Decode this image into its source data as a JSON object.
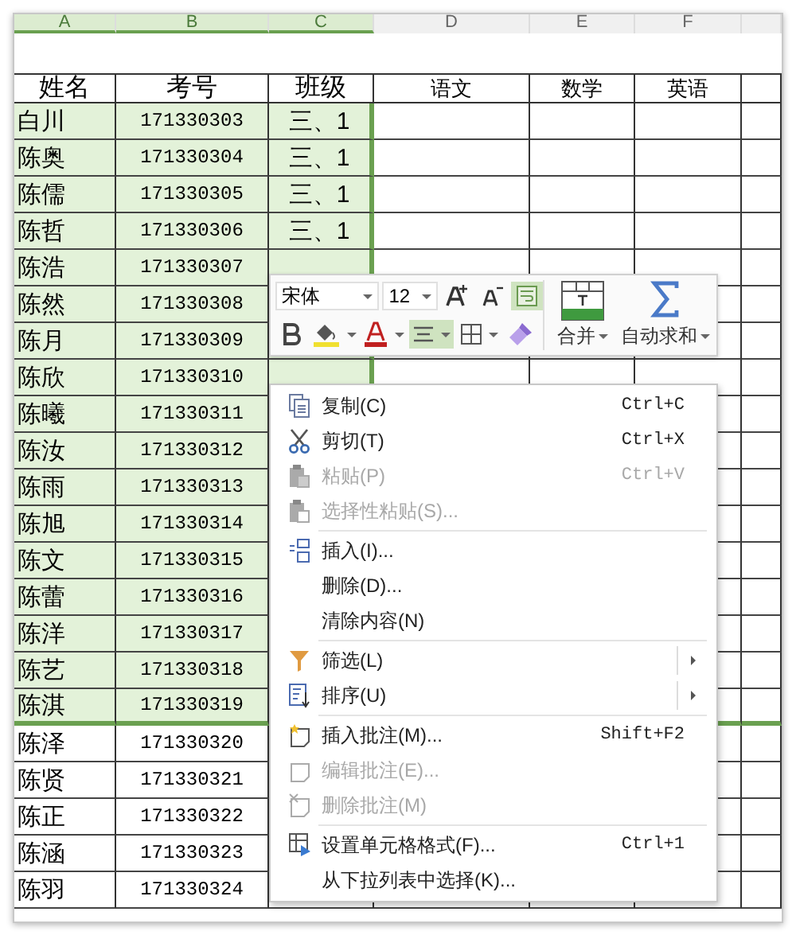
{
  "column_headers": [
    {
      "label": "A",
      "selected": true
    },
    {
      "label": "B",
      "selected": true
    },
    {
      "label": "C",
      "selected": true
    },
    {
      "label": "D",
      "selected": false
    },
    {
      "label": "E",
      "selected": false
    },
    {
      "label": "F",
      "selected": false
    }
  ],
  "table": {
    "columns": [
      "姓名",
      "考号",
      "班级",
      "语文",
      "数学",
      "英语"
    ],
    "rows": [
      {
        "name": "白川",
        "id": "171330303",
        "class": "三、1",
        "selected": true
      },
      {
        "name": "陈奥",
        "id": "171330304",
        "class": "三、1",
        "selected": true
      },
      {
        "name": "陈儒",
        "id": "171330305",
        "class": "三、1",
        "selected": true
      },
      {
        "name": "陈哲",
        "id": "171330306",
        "class": "三、1",
        "selected": true
      },
      {
        "name": "陈浩",
        "id": "171330307",
        "selected": true
      },
      {
        "name": "陈然",
        "id": "171330308",
        "selected": true
      },
      {
        "name": "陈月",
        "id": "171330309",
        "selected": true
      },
      {
        "name": "陈欣",
        "id": "171330310",
        "selected": true
      },
      {
        "name": "陈曦",
        "id": "171330311",
        "selected": true
      },
      {
        "name": "陈汝",
        "id": "171330312",
        "selected": true
      },
      {
        "name": "陈雨",
        "id": "171330313",
        "selected": true
      },
      {
        "name": "陈旭",
        "id": "171330314",
        "selected": true
      },
      {
        "name": "陈文",
        "id": "171330315",
        "selected": true
      },
      {
        "name": "陈蕾",
        "id": "171330316",
        "selected": true
      },
      {
        "name": "陈洋",
        "id": "171330317",
        "selected": true
      },
      {
        "name": "陈艺",
        "id": "171330318",
        "selected": true
      },
      {
        "name": "陈淇",
        "id": "171330319",
        "selected": true
      },
      {
        "name": "陈泽",
        "id": "171330320",
        "selected": false
      },
      {
        "name": "陈贤",
        "id": "171330321",
        "selected": false
      },
      {
        "name": "陈正",
        "id": "171330322",
        "selected": false
      },
      {
        "name": "陈涵",
        "id": "171330323",
        "selected": false
      },
      {
        "name": "陈羽",
        "id": "171330324",
        "selected": false
      }
    ]
  },
  "toolbar": {
    "font": "宋体",
    "size": "12",
    "row1_tools": [
      {
        "kind": "grow",
        "selected": false
      },
      {
        "kind": "shrink",
        "selected": false
      },
      {
        "kind": "wrap",
        "selected": true
      }
    ],
    "row2_tools": [
      {
        "kind": "bold",
        "selected": false
      },
      {
        "kind": "fill",
        "selected": false
      },
      {
        "kind": "color",
        "selected": false
      },
      {
        "kind": "align",
        "selected": true
      },
      {
        "kind": "borders",
        "selected": false
      },
      {
        "kind": "brush",
        "selected": false
      }
    ],
    "merge": "合并",
    "autosum": "自动求和"
  },
  "menu": {
    "groups": [
      [
        {
          "label": "复制(C)",
          "shortcut": "Ctrl+C",
          "disabled": false,
          "submenu": false
        },
        {
          "label": "剪切(T)",
          "shortcut": "Ctrl+X",
          "disabled": false,
          "submenu": false
        },
        {
          "label": "粘贴(P)",
          "shortcut": "Ctrl+V",
          "disabled": true,
          "submenu": false
        },
        {
          "label": "选择性粘贴(S)...",
          "disabled": true,
          "submenu": false
        }
      ],
      [
        {
          "label": "插入(I)...",
          "disabled": false,
          "submenu": false
        },
        {
          "label": "删除(D)...",
          "disabled": false,
          "submenu": false
        },
        {
          "label": "清除内容(N)",
          "disabled": false,
          "submenu": false
        }
      ],
      [
        {
          "label": "筛选(L)",
          "disabled": false,
          "submenu": true
        },
        {
          "label": "排序(U)",
          "disabled": false,
          "submenu": true
        }
      ],
      [
        {
          "label": "插入批注(M)...",
          "shortcut": "Shift+F2",
          "disabled": false,
          "submenu": false
        },
        {
          "label": "编辑批注(E)...",
          "disabled": true,
          "submenu": false
        },
        {
          "label": "删除批注(M)",
          "disabled": true,
          "submenu": false
        }
      ],
      [
        {
          "label": "设置单元格格式(F)...",
          "shortcut": "Ctrl+1",
          "disabled": false,
          "submenu": false
        },
        {
          "label": "从下拉列表中选择(K)...",
          "disabled": false,
          "submenu": false
        }
      ]
    ]
  }
}
